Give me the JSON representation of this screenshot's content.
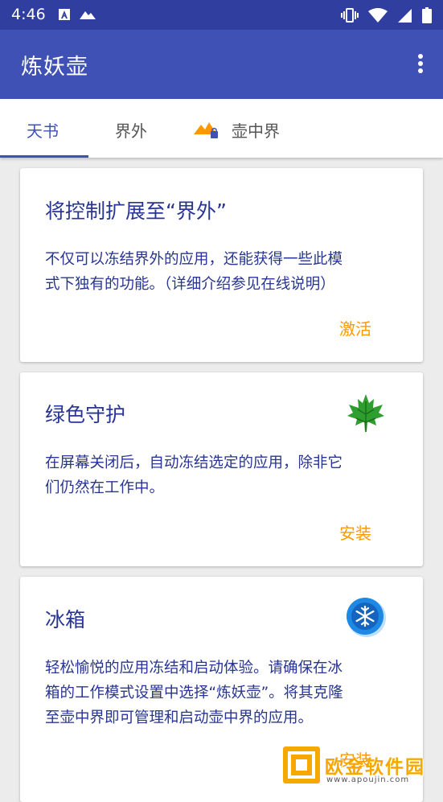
{
  "status_bar": {
    "time": "4:46",
    "left_icons": [
      "a-notification-icon",
      "signal-mountain-icon"
    ],
    "right_icons": [
      "vibrate-icon",
      "wifi-icon",
      "cell-signal-icon",
      "battery-icon"
    ]
  },
  "app_bar": {
    "title": "炼妖壶",
    "menu_icon": "more-vert-icon"
  },
  "tabs": [
    {
      "label": "天书",
      "active": true
    },
    {
      "label": "界外",
      "active": false
    },
    {
      "label": "壶中界",
      "active": false,
      "icon": "island-lock-icon"
    }
  ],
  "cards": [
    {
      "title": "将控制扩展至“界外”",
      "body": [
        "不仅可以冻结界外的应用，还能获得一些此模",
        "式下独有的功能。（详细介绍参见在线说明）"
      ],
      "action": "激活"
    },
    {
      "title": "绿色守护",
      "icon": "maple-leaf-icon",
      "body": [
        "在屏幕关闭后，自动冻结选定的应用，除非它",
        "们仍然在工作中。"
      ],
      "action": "安装"
    },
    {
      "title": "冰箱",
      "icon": "snowflake-icon",
      "body": [
        "轻松愉悦的应用冻结和启动体验。请确保在冰",
        "箱的工作模式设置中选择“炼妖壶”。将其克隆",
        "至壶中界即可管理和启动壶中界的应用。"
      ],
      "action": "安装"
    }
  ],
  "watermark": {
    "text": "欧金软件园",
    "url": "www.apoujin.com"
  },
  "colors": {
    "status_bar": "#303f9f",
    "app_bar": "#3f51b5",
    "card_text": "#283593",
    "action": "#ff9800",
    "watermark": "#f6a800"
  }
}
